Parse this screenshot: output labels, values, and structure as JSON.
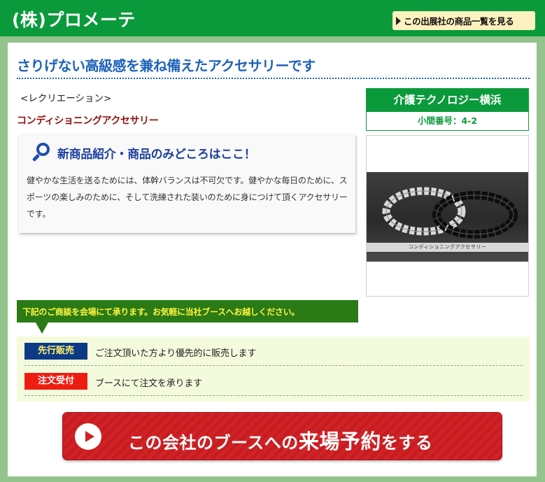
{
  "header": {
    "company_name": "(株)プロメーテ",
    "list_button_label": "この出展社の商品一覧を見る"
  },
  "main": {
    "headline": "さりげない高級感を兼ね備えたアクセサリーです",
    "category": "<レクリエーション>",
    "subcategory": "コンディショニングアクセサリー",
    "feature": {
      "title": "新商品紹介・商品のみどころはここ！",
      "body": "健やかな生活を送るためには、体幹バランスは不可欠です。健やかな毎日のために、スポーツの楽しみのために、そして洗練された装いのために身につけて頂くアクセサリーです。"
    }
  },
  "booth": {
    "venue_name": "介護テクノロジー横浜",
    "booth_number": "小間番号：4-2"
  },
  "photo": {
    "caption": "コンディショニングアクセサリー"
  },
  "notice": {
    "text": "下記のご商談を会場にて承ります。お気軽に当社ブースへお越しください。"
  },
  "sales": [
    {
      "badge": "先行販売",
      "text": "ご注文頂いた方より優先的に販売します",
      "badge_color": "#0c3a86"
    },
    {
      "badge": "注文受付",
      "text": "ブースにて注文を承ります",
      "badge_color": "#ee1d12"
    }
  ],
  "reserve_button": {
    "prefix": "この会社のブースへの",
    "emphasis": "来場予約",
    "suffix": "をする"
  },
  "colors": {
    "header_green": "#0b9a3b",
    "panel_green": "#95c38d",
    "headline_blue": "#1d63b8",
    "subcategory_red": "#8b1212",
    "notice_green": "#2a7a16",
    "notice_text_yellow": "#fff43f",
    "button_red": "#d12326"
  }
}
